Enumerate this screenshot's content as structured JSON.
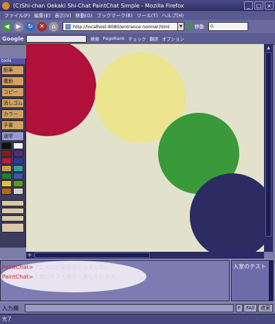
{
  "window": {
    "title": "(C)Shi-chan Oekaki Shi-Chat PaintChat Simple - Mozilla Firefox",
    "minimize": "_",
    "maximize": "□",
    "close": "×"
  },
  "menu": [
    "ファイル(F)",
    "編集(E)",
    "表示(V)",
    "移動(G)",
    "ブックマーク(B)",
    "ツール(T)",
    "ヘルプ(H)"
  ],
  "nav": {
    "url": "http://localhost:8080/entrance normal.html",
    "go_label": "移動",
    "search_placeholder": "G"
  },
  "google_toolbar": {
    "logo": "Google",
    "search_label": "検索",
    "pagerank": "PageRank",
    "check": "チェック",
    "translate": "翻訳",
    "options": "オプション"
  },
  "tools": {
    "header": "tools",
    "buttons": [
      "鉛筆",
      "覆鉛",
      "コピー",
      "消しゴム",
      "カラー",
      "手書",
      "通常"
    ],
    "slots": [
      "",
      "",
      "",
      ""
    ]
  },
  "palette": [
    "#111111",
    "#f0f0f0",
    "#8a1a1a",
    "#5a2a7a",
    "#b02040",
    "#2a3aa0",
    "#c8a040",
    "#2aa0a0",
    "#208040",
    "#3a5ab0",
    "#e0c040",
    "#5a9a2a",
    "#b06a20",
    "#d0d0d0"
  ],
  "canvas": {
    "background": "#e2e2cc",
    "circles": [
      {
        "color": "#b0103a"
      },
      {
        "color": "#ece48e"
      },
      {
        "color": "#3a9a3a"
      },
      {
        "color": "#2c2c62"
      }
    ]
  },
  "chat": {
    "messages": [
      {
        "prefix": "PaintChat>",
        "text": "アニメログ受信完了しました。"
      },
      {
        "prefix": "PaintChat>",
        "text": "入室のテスト様が入室しています。"
      }
    ],
    "users": [
      "入室のテスト"
    ]
  },
  "input": {
    "label": "入力欄",
    "buttons": [
      "F",
      "FAll",
      "退室"
    ]
  },
  "status": {
    "text": "完了"
  }
}
